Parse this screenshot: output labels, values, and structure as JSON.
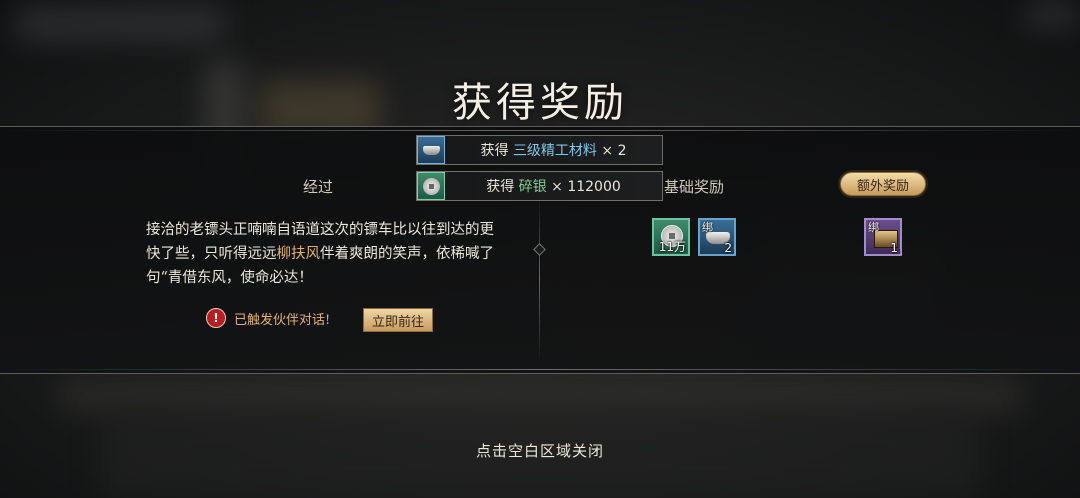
{
  "title": "获得奖励",
  "notifications": [
    {
      "prefix": "获得",
      "item": "三级精工材料",
      "times": "×",
      "qty": "2",
      "icon": "ingot-icon"
    },
    {
      "prefix": "获得",
      "item": "碎银",
      "times": "×",
      "qty": "112000",
      "icon": "silver-coin-icon"
    }
  ],
  "left": {
    "heading": "经过",
    "story": {
      "part1": "接洽的老镖头正喃喃自语道这次的镖车比以往到达的更快了些，只听得远远",
      "highlight": "柳扶风",
      "part2": "伴着爽朗的笑声，依稀喊了句“青借东风，使命必达！"
    },
    "alert_icon": "!",
    "alert_text": "已触发伙伴对话!",
    "go_button": "立即前往"
  },
  "base": {
    "heading": "基础奖励",
    "items": [
      {
        "icon": "silver-coin-icon",
        "count": "11万"
      },
      {
        "icon": "ingot-icon",
        "bind": "绑",
        "count": "2"
      }
    ]
  },
  "extra": {
    "heading": "额外奖励",
    "items": [
      {
        "icon": "treasure-chest-icon",
        "bind": "绑",
        "count": "1"
      }
    ]
  },
  "close_hint": "点击空白区域关闭"
}
